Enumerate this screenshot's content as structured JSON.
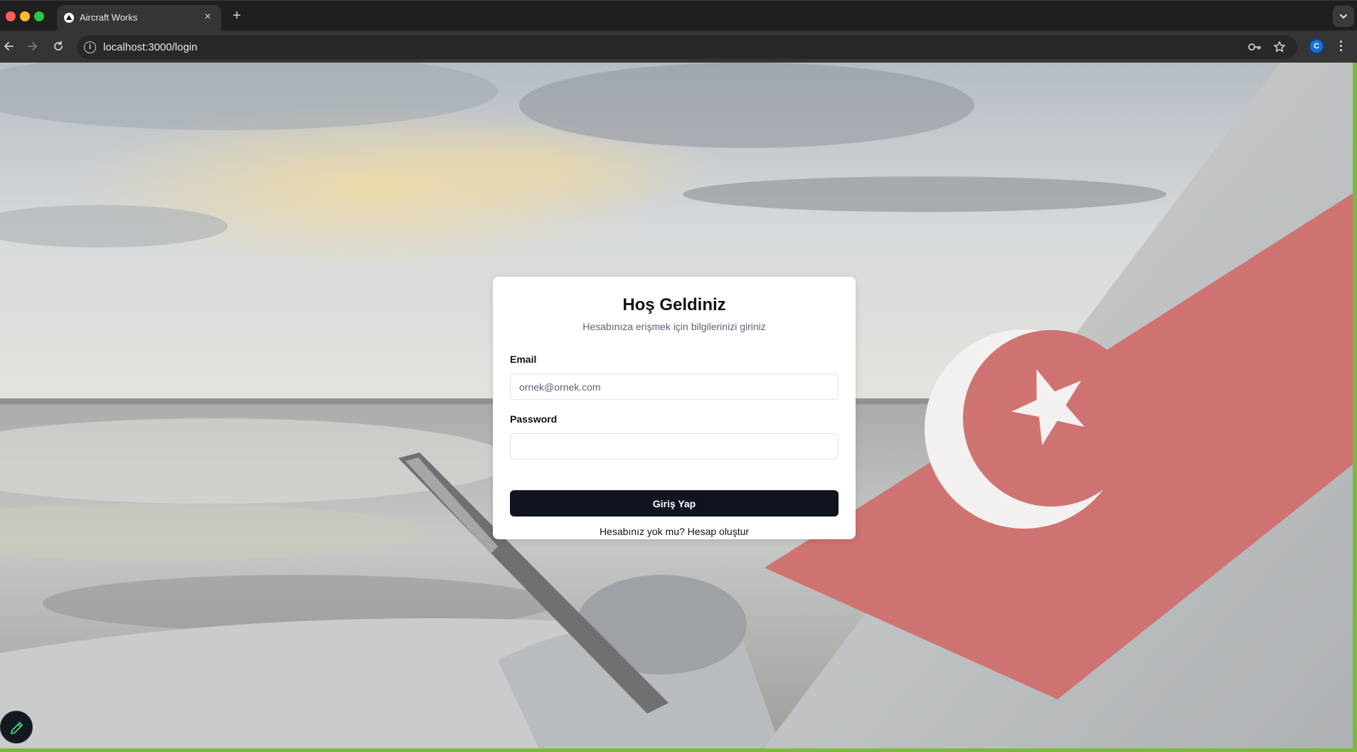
{
  "browser": {
    "tab_title": "Aircraft Works",
    "tab_close": "×",
    "new_tab": "+",
    "url": "localhost:3000/login",
    "profile_initial": "C",
    "info_glyph": "i"
  },
  "login": {
    "title": "Hoş Geldiniz",
    "subtitle": "Hesabınıza erişmek için bilgilerinizi giriniz",
    "email_label": "Email",
    "email_placeholder": "ornek@ornek.com",
    "password_label": "Password",
    "password_value": "",
    "submit_label": "Giriş Yap",
    "signup_prompt": "Hesabınız yok mu?",
    "signup_link": "Hesap oluştur"
  },
  "colors": {
    "button_bg": "#0f1420",
    "accent_edge": "#79b93b",
    "flag_red": "#cf7372",
    "profile_blue": "#1a6fd0"
  },
  "icons": [
    "back-arrow-icon",
    "forward-arrow-icon",
    "reload-icon",
    "info-icon",
    "password-key-icon",
    "bookmark-star-icon",
    "more-menu-icon",
    "tab-list-chevron-icon",
    "pencil-edit-icon"
  ]
}
